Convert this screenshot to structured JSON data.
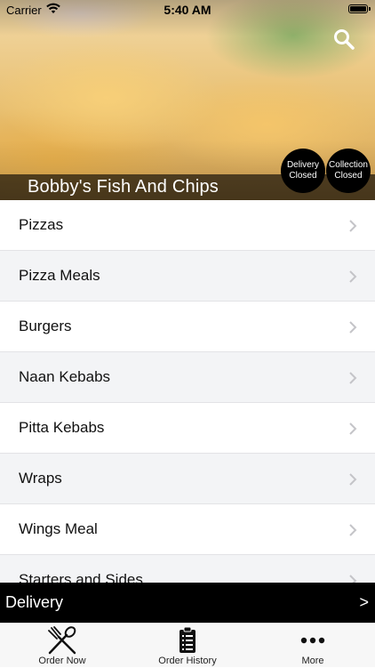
{
  "status_bar": {
    "carrier": "Carrier",
    "time": "5:40 AM"
  },
  "hero": {
    "restaurant_name": "Bobby's Fish And Chips",
    "delivery_status": {
      "line1": "Delivery",
      "line2": "Closed"
    },
    "collection_status": {
      "line1": "Collection",
      "line2": "Closed"
    },
    "search_icon": "search-icon"
  },
  "menu": {
    "items": [
      {
        "label": "Pizzas"
      },
      {
        "label": "Pizza Meals"
      },
      {
        "label": "Burgers"
      },
      {
        "label": "Naan Kebabs"
      },
      {
        "label": "Pitta Kebabs"
      },
      {
        "label": "Wraps"
      },
      {
        "label": "Wings Meal"
      },
      {
        "label": "Starters and Sides"
      }
    ],
    "chevron_icon": "chevron-right-icon"
  },
  "delivery_bar": {
    "label": "Delivery",
    "arrow": ">"
  },
  "tab_bar": {
    "tabs": [
      {
        "label": "Order Now",
        "icon": "fork-knife-icon"
      },
      {
        "label": "Order History",
        "icon": "clipboard-list-icon"
      },
      {
        "label": "More",
        "icon": "more-dots-icon"
      }
    ]
  },
  "colors": {
    "bar_background": "#000000",
    "row_alt": "#f3f4f6",
    "tab_bar_bg": "#f7f7f7"
  }
}
